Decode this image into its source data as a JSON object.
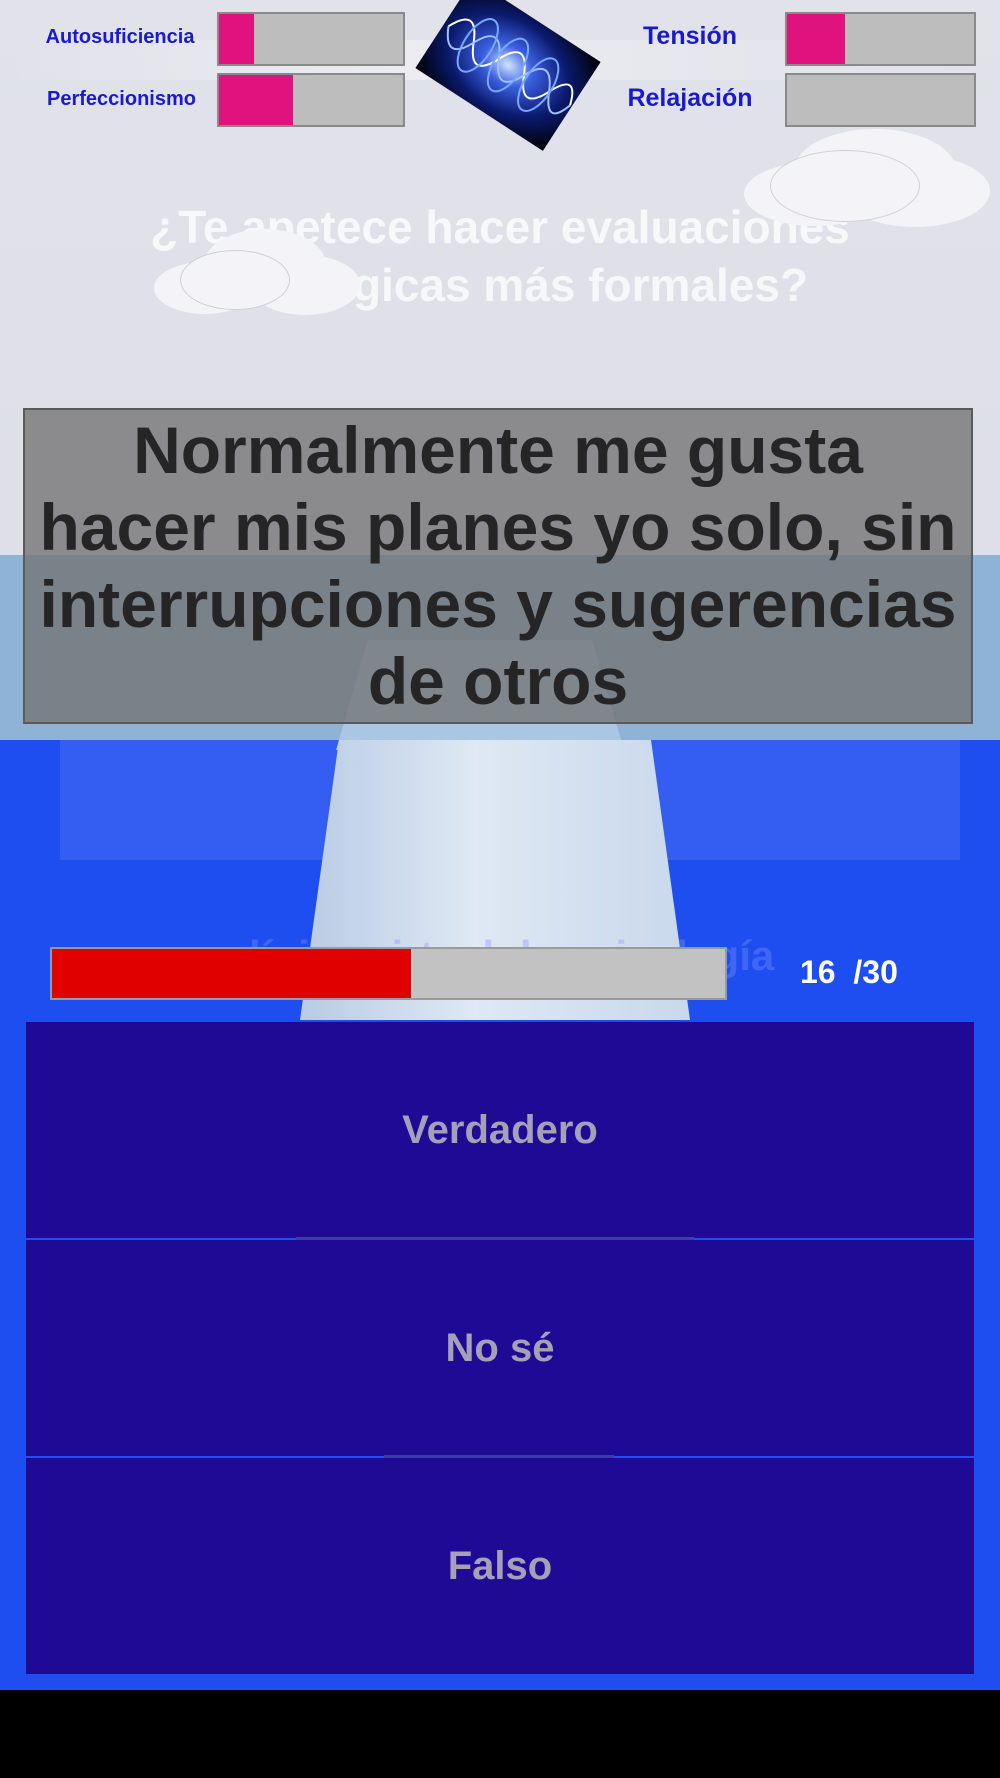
{
  "header": {
    "stats": [
      {
        "label": "Autosuficiencia",
        "level": 0.19
      },
      {
        "label": "Perfeccionismo",
        "level": 0.4
      },
      {
        "label": "Tensión",
        "level": 0.31
      },
      {
        "label": "Relajación",
        "level": 0.0
      }
    ],
    "meter_fill_color": "#e0137e",
    "logo_icon": "energy-waves-icon"
  },
  "background": {
    "promo_title": "¿Te apetece hacer evaluaciones psicológicas más formales?",
    "promo_subtitle": "clínica virtual de psicología"
  },
  "question": {
    "text": "Normalmente me gusta hacer mis planes yo solo, sin interrupciones y sugerencias de otros"
  },
  "progress": {
    "current": 16,
    "total": 30,
    "display": "16  /30",
    "fill_color": "#e00000"
  },
  "answers": [
    {
      "label": "Verdadero"
    },
    {
      "label": "No sé"
    },
    {
      "label": "Falso"
    }
  ],
  "colors": {
    "answer_bg": "#1e0a95",
    "label_blue": "#1a1acc",
    "blue_band": "#1f4ef0"
  }
}
